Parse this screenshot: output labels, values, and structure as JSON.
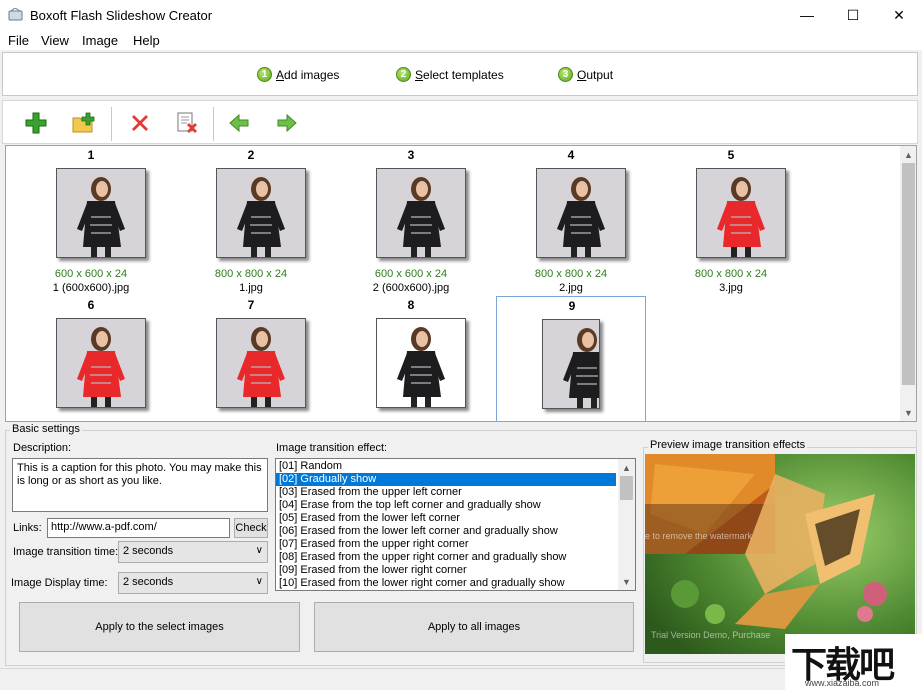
{
  "window": {
    "title": "Boxoft Flash Slideshow Creator",
    "minimize": "—",
    "maximize": "☐",
    "close": "✕"
  },
  "menu": [
    "File",
    "View",
    "Image",
    "Help"
  ],
  "steps": [
    {
      "num": "1",
      "label": "Add images"
    },
    {
      "num": "2",
      "label": "Select templates"
    },
    {
      "num": "3",
      "label": "Output"
    }
  ],
  "toolbar": {
    "icons": [
      "add-icon",
      "add-folder-icon",
      "delete-icon",
      "delete-all-icon",
      "move-left-icon",
      "move-right-icon"
    ]
  },
  "thumbnails": [
    {
      "index": "1",
      "dims": "600 x 600 x 24",
      "name": "1 (600x600).jpg",
      "shirt": "black"
    },
    {
      "index": "2",
      "dims": "800 x 800 x 24",
      "name": "1.jpg",
      "shirt": "black"
    },
    {
      "index": "3",
      "dims": "600 x 600 x 24",
      "name": "2 (600x600).jpg",
      "shirt": "black"
    },
    {
      "index": "4",
      "dims": "800 x 800 x 24",
      "name": "2.jpg",
      "shirt": "black"
    },
    {
      "index": "5",
      "dims": "800 x 800 x 24",
      "name": "3.jpg",
      "shirt": "red"
    },
    {
      "index": "6",
      "dims": "",
      "name": "",
      "shirt": "red"
    },
    {
      "index": "7",
      "dims": "",
      "name": "",
      "shirt": "red"
    },
    {
      "index": "8",
      "dims": "",
      "name": "",
      "shirt": "black"
    },
    {
      "index": "9",
      "dims": "",
      "name": "",
      "shirt": "black"
    }
  ],
  "settings": {
    "group_title": "Basic settings",
    "description_label": "Description:",
    "description": "This is a caption for this photo. You may make this is long or as short as you like.",
    "links_label": "Links:",
    "links_value": "http://www.a-pdf.com/",
    "check_label": "Check",
    "transition_time_label": "Image transition time:",
    "transition_time_value": "2 seconds",
    "display_time_label": "Image Display time:",
    "display_time_value": "2 seconds",
    "effect_label": "Image transition effect:",
    "effects": [
      "[01] Random",
      "[02] Gradually show",
      "[03] Erased from the upper left corner",
      "[04] Erase from the top left corner and gradually show",
      "[05] Erased from the lower left corner",
      "[06] Erased from the lower left corner and gradually show",
      "[07] Erased from the upper right corner",
      "[08] Erased from the upper right corner and gradually show",
      "[09] Erased from the lower right corner",
      "[10] Erased from the lower right corner and gradually show"
    ],
    "selected_effect": 1,
    "preview_label": "Preview image transition effects",
    "watermark_1": "e to remove the watermark",
    "watermark_2": "Trial Version Demo, Purchase",
    "apply_select": "Apply to the select images",
    "apply_all": "Apply to all images"
  },
  "site_logo": {
    "big": "下载吧",
    "small": "www.xiazaiba.com"
  },
  "colors": {
    "accent": "#0078d7",
    "dims_text": "#2e7d1a",
    "step_green": "#5aa51e"
  }
}
